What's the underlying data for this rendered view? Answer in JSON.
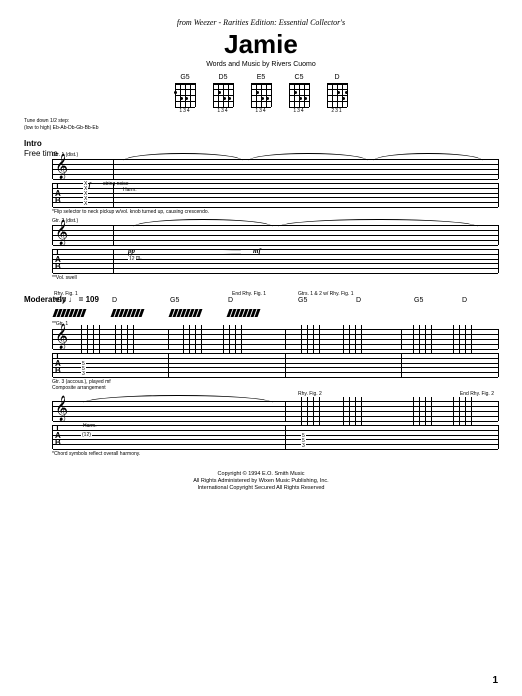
{
  "header": {
    "source": "from Weezer - Rarities Edition: Essential Collector's",
    "title": "Jamie",
    "credits": "Words and Music by Rivers Cuomo"
  },
  "chords": [
    {
      "name": "G5",
      "fingering": "134"
    },
    {
      "name": "D5",
      "fingering": "134"
    },
    {
      "name": "E5",
      "fingering": "134"
    },
    {
      "name": "C5",
      "fingering": "134"
    },
    {
      "name": "D",
      "fingering": "231"
    }
  ],
  "tuning": {
    "line1": "Tune down 1/2 step:",
    "line2": "(low to high) Eb-Ab-Db-Gb-Bb-Eb"
  },
  "intro": {
    "section": "Intro",
    "tempo": "Free time",
    "gtr1": "Gtr. 1 (dist.)",
    "gtr2": "Gtr. 2 (dist.)",
    "dyn_mf": "mf",
    "dyn_pp": "pp",
    "string_noise": "string noise",
    "harm": "Harm.",
    "vol_swell": "**Vol. swell",
    "footnote1": "*Flip selector to neck pickup w/vol. knob turned up, causing crescendo.",
    "tab_harm": "12"
  },
  "main": {
    "tempo": "Moderately ♩ = 109",
    "chord_seq": [
      "*G5",
      "D",
      "G5",
      "D",
      "G5",
      "D",
      "G5",
      "D"
    ],
    "rhy_fig1": "Rhy. Fig. 1",
    "end_rhy_fig1": "End Rhy. Fig. 1",
    "gtrs12": "Gtrs. 1 & 2 w/ Rhy. Fig. 1",
    "gtr1_label": "**Gtr. 1",
    "gtr3_label": "Gtr. 3 (accous.), played mf",
    "comp_arr": "Composite arrangement",
    "rhy_fig2": "Rhy. Fig. 2",
    "end_rhy_fig2": "End Rhy. Fig. 2",
    "tab_g": [
      "3",
      "3",
      "5"
    ],
    "tab_d": [
      "2",
      "3",
      "2"
    ],
    "footnote_chords": "*Chord symbols reflect overall harmony.",
    "harm": "Harm.",
    "harm_tab": "(12)"
  },
  "footer": {
    "c1": "Copyright © 1994 E.O. Smith Music",
    "c2": "All Rights Administered by Wixen Music Publishing, Inc.",
    "c3": "International Copyright Secured   All Rights Reserved",
    "page": "1"
  }
}
